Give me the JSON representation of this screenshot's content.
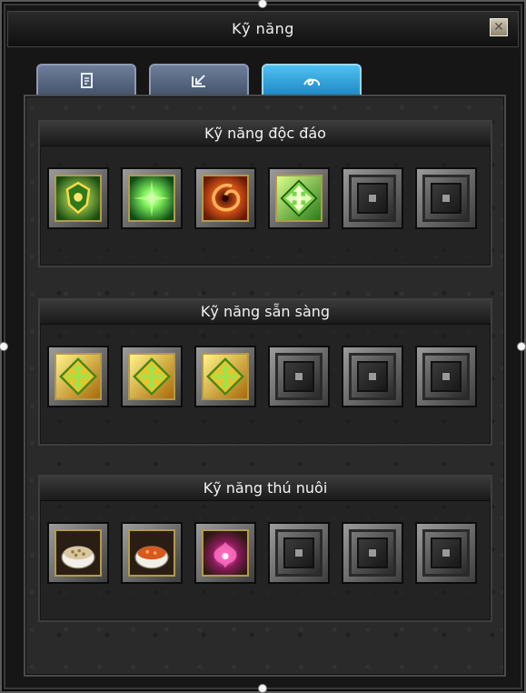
{
  "window": {
    "title": "Kỹ năng",
    "close_symbol": "✕"
  },
  "tabs": [
    {
      "icon": "document-icon",
      "active": false
    },
    {
      "icon": "arrow-down-left-icon",
      "active": false
    },
    {
      "icon": "swirl-skill-icon",
      "active": true
    }
  ],
  "sections": [
    {
      "title": "Kỹ năng độc đáo",
      "slots": [
        "green-shield-skill-icon",
        "green-burst-skill-icon",
        "orange-vortex-skill-icon",
        "green-arrows-skill-icon",
        "empty",
        "empty"
      ]
    },
    {
      "title": "Kỹ năng sẵn sàng",
      "slots": [
        "gold-arrows-skill-icon",
        "gold-arrows-skill-icon",
        "gold-arrows-skill-icon",
        "empty",
        "empty",
        "empty"
      ]
    },
    {
      "title": "Kỹ năng thú nuôi",
      "slots": [
        "grain-bowl-item-icon",
        "soup-bowl-item-icon",
        "pink-flower-skill-icon",
        "empty",
        "empty",
        "empty"
      ]
    }
  ],
  "colors": {
    "active_tab": "#2a9ad8",
    "inactive_tab": "#56657f",
    "slot_frame_gold": "#b39a4a",
    "background": "#161616"
  }
}
